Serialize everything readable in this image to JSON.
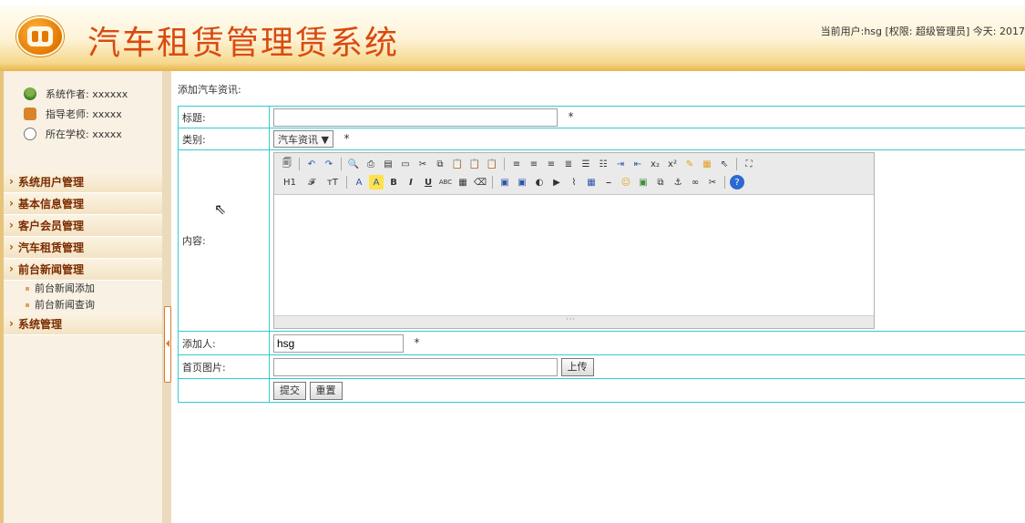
{
  "header": {
    "title": "汽车租赁管理赁系统",
    "user_info": "当前用户:hsg [权限: 超级管理员] 今天: 2017"
  },
  "sidebar": {
    "info": [
      {
        "label": "系统作者: xxxxxx",
        "icon": "user-group-icon"
      },
      {
        "label": "指导老师: xxxxx",
        "icon": "teacher-icon"
      },
      {
        "label": "所在学校: xxxxx",
        "icon": "school-icon"
      }
    ],
    "menu": [
      {
        "label": "系统用户管理"
      },
      {
        "label": "基本信息管理"
      },
      {
        "label": "客户会员管理"
      },
      {
        "label": "汽车租赁管理"
      },
      {
        "label": "前台新闻管理",
        "sub": [
          "前台新闻添加",
          "前台新闻查询"
        ]
      },
      {
        "label": "系统管理"
      }
    ]
  },
  "main": {
    "heading": "添加汽车资讯:",
    "fields": {
      "title_label": "标题:",
      "title_value": "",
      "category_label": "类别:",
      "category_value": "汽车资讯",
      "content_label": "内容:",
      "author_label": "添加人:",
      "author_value": "hsg",
      "image_label": "首页图片:",
      "image_value": "",
      "required_mark": "*"
    },
    "buttons": {
      "upload": "上传",
      "submit": "提交",
      "reset": "重置",
      "dropdown_arrow": "▼"
    },
    "editor_toolbar": {
      "row1": [
        "source-icon",
        "undo-icon",
        "redo-icon",
        "preview-icon",
        "print-icon",
        "template-icon",
        "paste-plain-icon",
        "cut-icon",
        "copy-icon",
        "paste-icon",
        "paste-word-icon",
        "paste-text-icon",
        "align-left-icon",
        "align-center-icon",
        "align-right-icon",
        "justify-icon",
        "ordered-list-icon",
        "bullet-list-icon",
        "indent-icon",
        "outdent-icon",
        "subscript-icon",
        "superscript-icon",
        "clear-format-icon",
        "select-all-icon",
        "fullscreen-icon"
      ],
      "row2_labels": [
        "H1",
        "𝓕",
        "тT",
        "A",
        "A",
        "B",
        "I",
        "U",
        "ABC"
      ]
    }
  }
}
